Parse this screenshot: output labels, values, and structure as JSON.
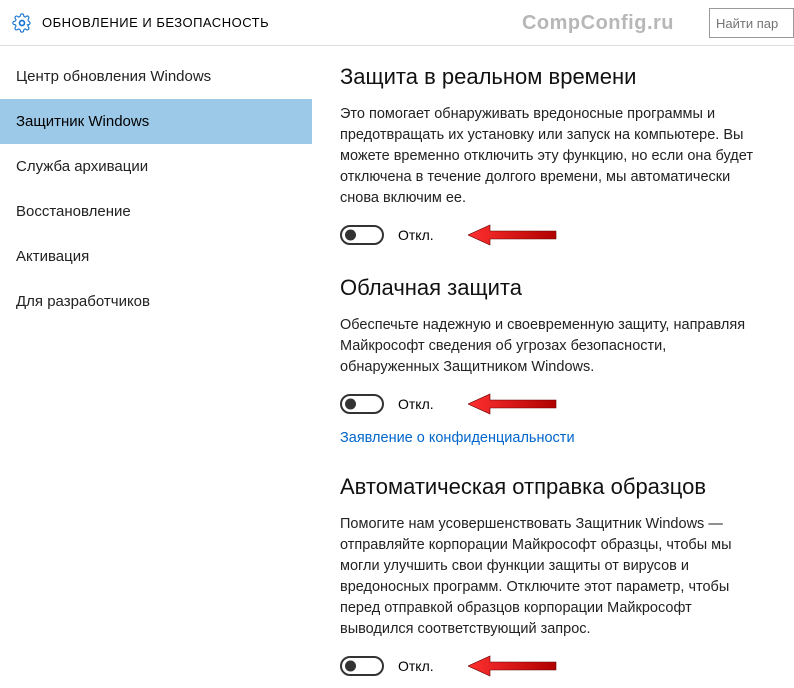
{
  "header": {
    "title": "ОБНОВЛЕНИЕ И БЕЗОПАСНОСТЬ",
    "watermark": "CompConfig.ru",
    "search_placeholder": "Найти пар"
  },
  "sidebar": {
    "items": [
      {
        "label": "Центр обновления Windows",
        "active": false
      },
      {
        "label": "Защитник Windows",
        "active": true
      },
      {
        "label": "Служба архивации",
        "active": false
      },
      {
        "label": "Восстановление",
        "active": false
      },
      {
        "label": "Активация",
        "active": false
      },
      {
        "label": "Для разработчиков",
        "active": false
      }
    ]
  },
  "content": {
    "sections": [
      {
        "heading": "Защита в реальном времени",
        "body": "Это помогает обнаруживать вредоносные программы и предотвращать их установку или запуск на компьютере. Вы можете временно отключить эту функцию, но если она будет отключена в течение долгого времени, мы автоматически снова включим ее.",
        "toggle_label": "Откл."
      },
      {
        "heading": "Облачная защита",
        "body": "Обеспечьте надежную и своевременную защиту, направляя Майкрософт сведения об угрозах безопасности, обнаруженных Защитником Windows.",
        "toggle_label": "Откл.",
        "link": "Заявление о конфиденциальности"
      },
      {
        "heading": "Автоматическая отправка образцов",
        "body": "Помогите нам усовершенствовать Защитник Windows — отправляйте корпорации Майкрософт образцы, чтобы мы могли улучшить свои функции защиты от вирусов и вредоносных программ. Отключите этот параметр, чтобы перед отправкой образцов корпорации Майкрософт выводился соответствующий запрос.",
        "toggle_label": "Откл."
      }
    ]
  }
}
